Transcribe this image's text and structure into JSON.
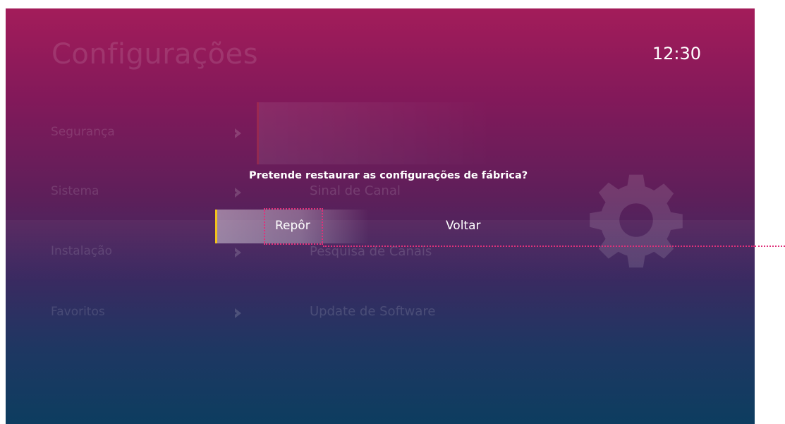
{
  "header": {
    "title": "Configurações",
    "clock": "12:30"
  },
  "menu": {
    "items": [
      {
        "label": "Segurança"
      },
      {
        "label": "Sistema"
      },
      {
        "label": "Instalação"
      },
      {
        "label": "Favoritos"
      }
    ]
  },
  "submenu": {
    "items": [
      {
        "label": "Sinal de Canal"
      },
      {
        "label": "Pesquisa de Canais"
      },
      {
        "label": "Update de Software"
      }
    ]
  },
  "dialog": {
    "question": "Pretende restaurar as configurações de fábrica?",
    "confirm_label": "Repôr",
    "cancel_label": "Voltar"
  },
  "icons": {
    "background": "gear-icon",
    "menu_arrow": "chevron-right-icon"
  },
  "colors": {
    "accent": "#f2c21b",
    "focus_indicator": "#e0307a",
    "gradient_top": "#a31c5a",
    "gradient_bottom": "#0d3d60"
  }
}
